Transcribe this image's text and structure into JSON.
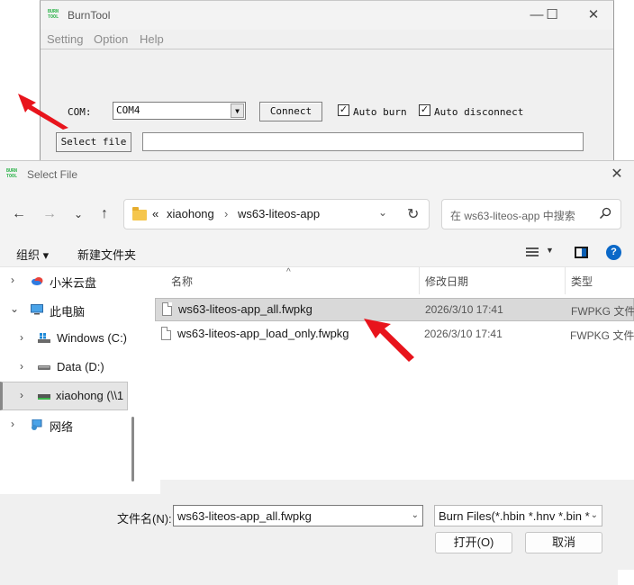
{
  "burntool": {
    "title": "BurnTool",
    "logo_text": "BURN TOOL",
    "window_controls": {
      "minimize": "—",
      "maximize": "☐",
      "close": "✕"
    },
    "menu": [
      "Setting",
      "Option",
      "Help"
    ],
    "com_label": "COM:",
    "com_value": "COM4",
    "connect_label": "Connect",
    "auto_burn_label": "Auto burn",
    "auto_burn_checked": true,
    "auto_disconnect_label": "Auto disconnect",
    "auto_disconnect_checked": true,
    "select_file_label": "Select file",
    "file_path_value": ""
  },
  "dialog": {
    "title": "Select File",
    "breadcrumb": {
      "overflow": "«",
      "segments": [
        "xiaohong",
        "ws63-liteos-app"
      ],
      "separator": "›"
    },
    "search_placeholder": "在 ws63-liteos-app 中搜索",
    "toolbar": {
      "organize": "组织 ▾",
      "new_folder": "新建文件夹"
    },
    "nav_tree": [
      {
        "label": "小米云盘",
        "icon": "cloud-icon"
      },
      {
        "label": "此电脑",
        "icon": "computer-icon"
      },
      {
        "label": "Windows (C:)",
        "icon": "windows-drive-icon"
      },
      {
        "label": "Data (D:)",
        "icon": "drive-icon"
      },
      {
        "label": "xiaohong (\\\\1",
        "icon": "network-drive-icon"
      },
      {
        "label": "网络",
        "icon": "network-icon"
      }
    ],
    "columns": {
      "name": "名称",
      "date": "修改日期",
      "type": "类型"
    },
    "files": [
      {
        "name": "ws63-liteos-app_all.fwpkg",
        "date": "2026/3/10 17:41",
        "type": "FWPKG 文件",
        "selected": true
      },
      {
        "name": "ws63-liteos-app_load_only.fwpkg",
        "date": "2026/3/10 17:41",
        "type": "FWPKG 文件",
        "selected": false
      }
    ],
    "filename_label": "文件名(N):",
    "filename_value": "ws63-liteos-app_all.fwpkg",
    "filter_value": "Burn Files(*.hbin *.hnv *.bin *",
    "open_label": "打开(O)",
    "cancel_label": "取消"
  },
  "colors": {
    "annotation": "#e8141c",
    "selection": "#d9d9d9",
    "accent": "#0a68c8",
    "logo": "#2db34a"
  }
}
